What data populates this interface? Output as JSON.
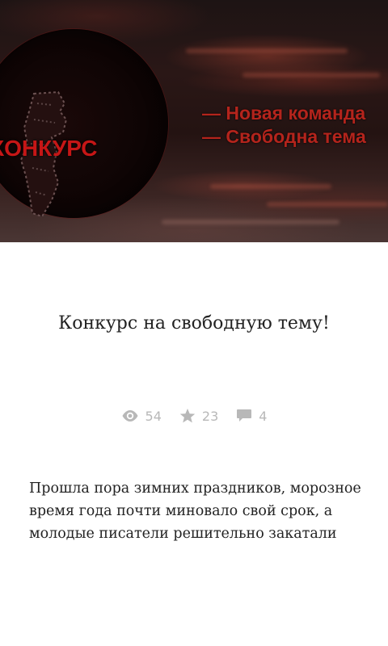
{
  "banner": {
    "circle_label": "КОНКУРС",
    "promo_lines": [
      "— Новая команда",
      "— Свободна тема"
    ]
  },
  "article": {
    "title": "Конкурс на свободную тему!",
    "views": "54",
    "likes": "23",
    "comments": "4",
    "excerpt": "Прошла пора зимних праздников, морозное время года почти миновало свой срок, а молодые писатели решительно закатали"
  },
  "colors": {
    "accent_red": "#c61616",
    "stat_gray": "#b8b8b8",
    "text": "#222222"
  },
  "icons": [
    "eye-icon",
    "star-icon",
    "comment-icon"
  ]
}
